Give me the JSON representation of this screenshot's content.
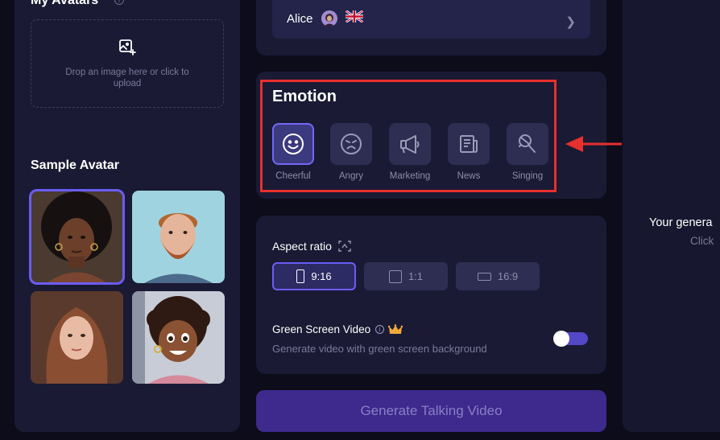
{
  "left_panel": {
    "my_avatars_title": "My Avatars",
    "upload_text": "Drop an image here or click to upload",
    "sample_avatar_title": "Sample Avatar",
    "avatars": [
      {
        "name": "avatar-afro-woman",
        "selected": true
      },
      {
        "name": "avatar-bearded-man",
        "selected": false
      },
      {
        "name": "avatar-long-hair-woman",
        "selected": false
      },
      {
        "name": "avatar-cartoon-girl",
        "selected": false
      }
    ]
  },
  "voice": {
    "name": "Alice",
    "flag_icon": "uk-flag-icon"
  },
  "emotion": {
    "title": "Emotion",
    "items": [
      {
        "label": "Cheerful",
        "icon": "smile-icon",
        "active": true
      },
      {
        "label": "Angry",
        "icon": "angry-face-icon",
        "active": false
      },
      {
        "label": "Marketing",
        "icon": "megaphone-icon",
        "active": false
      },
      {
        "label": "News",
        "icon": "newspaper-icon",
        "active": false
      },
      {
        "label": "Singing",
        "icon": "microphone-icon",
        "active": false
      }
    ]
  },
  "aspect": {
    "title": "Aspect ratio",
    "options": [
      {
        "label": "9:16",
        "active": true
      },
      {
        "label": "1:1",
        "active": false
      },
      {
        "label": "16:9",
        "active": false
      }
    ]
  },
  "green_screen": {
    "title": "Green Screen Video",
    "description": "Generate video with green screen background",
    "enabled": false
  },
  "generate_button": "Generate Talking Video",
  "preview": {
    "title": "Your genera",
    "subtitle": "Click"
  },
  "colors": {
    "accent": "#6b5cf5",
    "highlight": "#e8302c",
    "panel": "#1a1a35",
    "background": "#0d0c1a"
  }
}
